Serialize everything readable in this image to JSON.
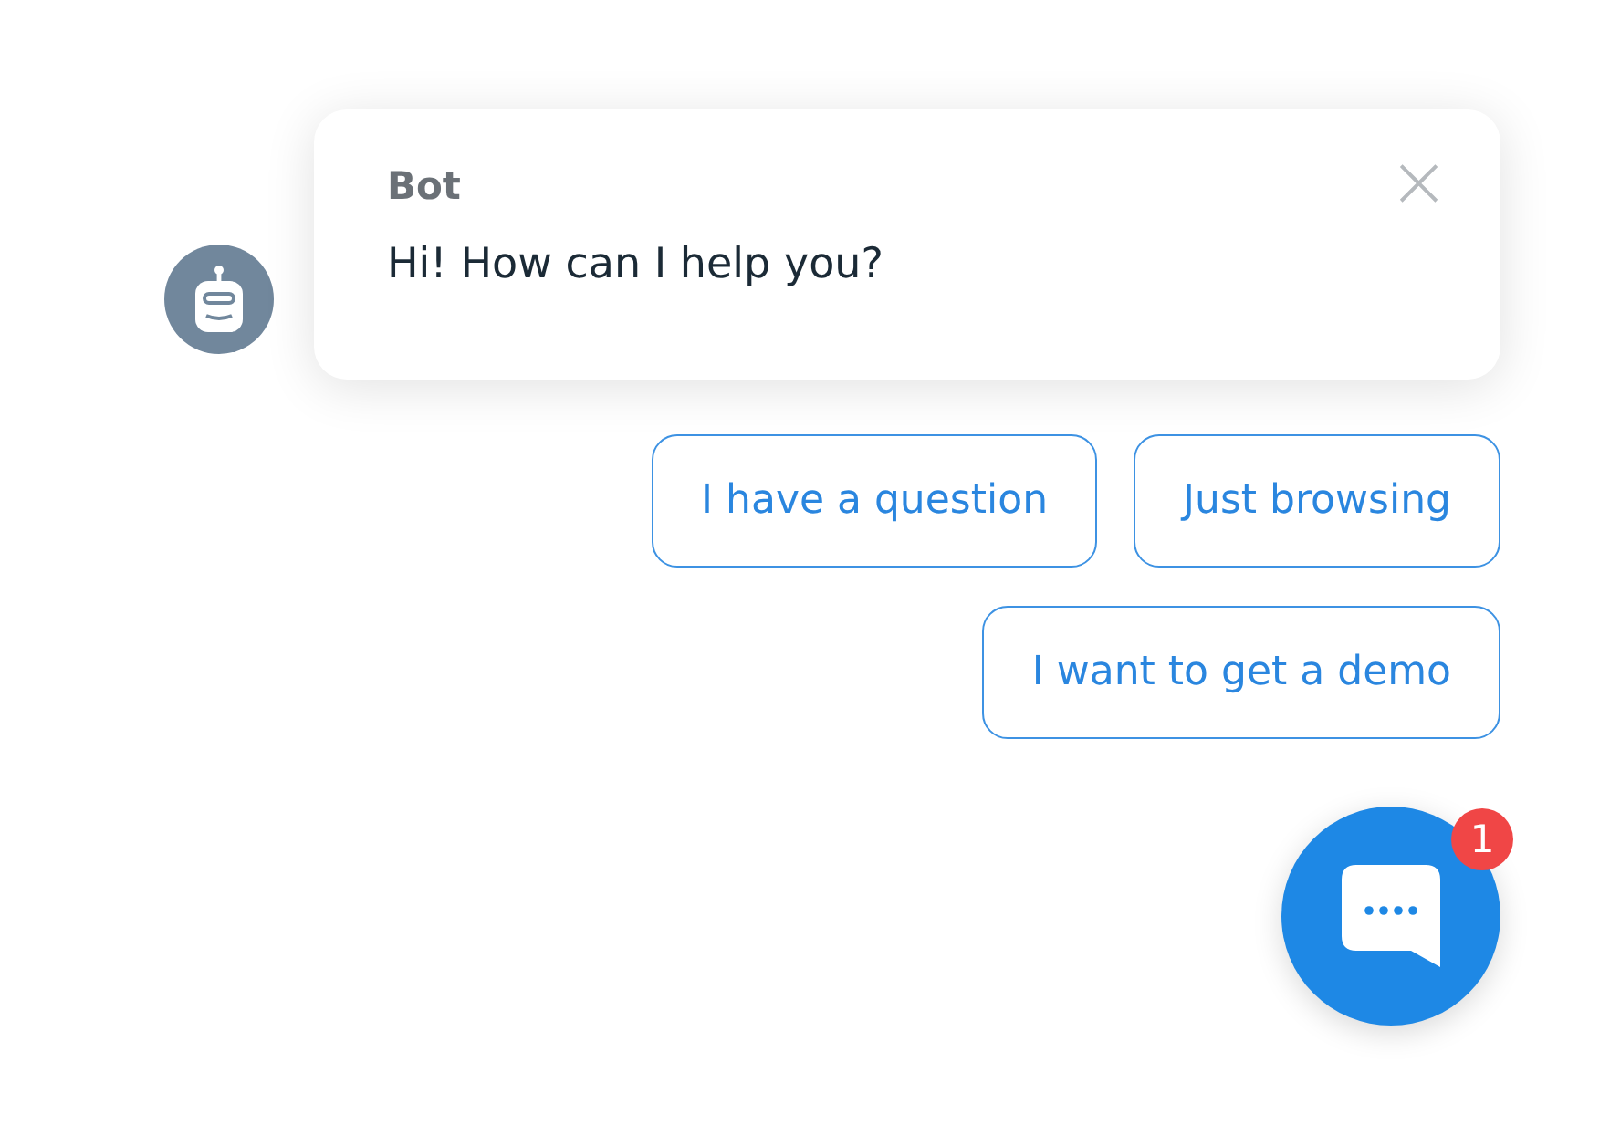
{
  "message": {
    "sender": "Bot",
    "text": "Hi! How can I help you?",
    "close": "×"
  },
  "quick_replies": [
    [
      {
        "label": "I have a question"
      },
      {
        "label": "Just browsing"
      }
    ],
    [
      {
        "label": "I want to get a demo"
      }
    ]
  ],
  "launcher": {
    "badge": "1"
  }
}
